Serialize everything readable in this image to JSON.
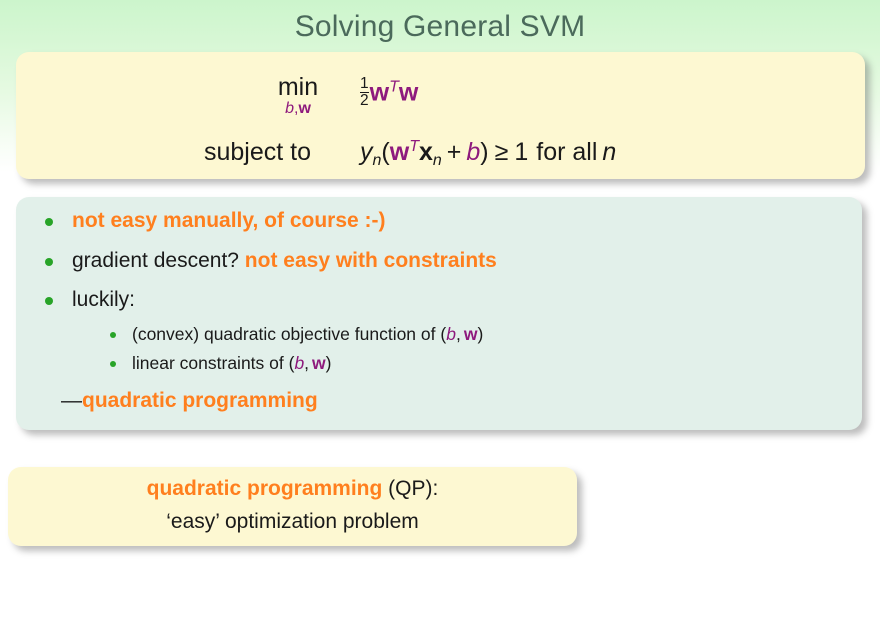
{
  "slide": {
    "title": "Solving General SVM",
    "colors": {
      "title": "#4b6a5b",
      "accent_orange": "#ff7f1e",
      "accent_purple": "#8e1a7d",
      "bullet_green": "#28a428",
      "box_yellow": "#fdf8d2",
      "box_mint": "#e2f0ea",
      "background_green": "#ccf5cc"
    }
  },
  "formula": {
    "min_op": "min",
    "min_limits": "b,w",
    "min_limits_var_b": "b",
    "min_limits_comma": ",",
    "min_limits_var_w": "w",
    "objective_num": "1",
    "objective_den": "2",
    "objective_w1": "w",
    "objective_T": "T",
    "objective_w2": "w",
    "subject_label": "subject to",
    "constraint_y": "y",
    "constraint_y_sub": "n",
    "constraint_open": "(",
    "constraint_w": "w",
    "constraint_T": "T",
    "constraint_x": "x",
    "constraint_x_sub": "n",
    "constraint_plus": "+",
    "constraint_b": "b",
    "constraint_close": ")",
    "constraint_geq": "≥",
    "constraint_one": "1",
    "constraint_forall": "for all",
    "constraint_n": "n"
  },
  "bullets": [
    {
      "level": 1,
      "segments": [
        {
          "text": "not easy manually, of course :-)",
          "style": "orange"
        }
      ]
    },
    {
      "level": 1,
      "segments": [
        {
          "text": "gradient descent? ",
          "style": "plain"
        },
        {
          "text": "not easy with constraints",
          "style": "orange"
        }
      ]
    },
    {
      "level": 1,
      "segments": [
        {
          "text": "luckily:",
          "style": "plain"
        }
      ]
    },
    {
      "level": 2,
      "segments": [
        {
          "text": "(convex) quadratic objective function of (",
          "style": "plain"
        },
        {
          "text": "b",
          "style": "purple-italic"
        },
        {
          "text": ",",
          "style": "plain"
        },
        {
          "text": "w",
          "style": "purple-bold"
        },
        {
          "text": ")",
          "style": "plain"
        }
      ]
    },
    {
      "level": 2,
      "segments": [
        {
          "text": "linear constraints of (",
          "style": "plain"
        },
        {
          "text": "b",
          "style": "purple-italic"
        },
        {
          "text": ",",
          "style": "plain"
        },
        {
          "text": "w",
          "style": "purple-bold"
        },
        {
          "text": ")",
          "style": "plain"
        }
      ]
    }
  ],
  "conclusion": {
    "dash": "—",
    "text": "quadratic programming"
  },
  "qp_box": {
    "term": "quadratic programming",
    "abbrev": " (QP):",
    "description": "‘easy’ optimization problem"
  }
}
